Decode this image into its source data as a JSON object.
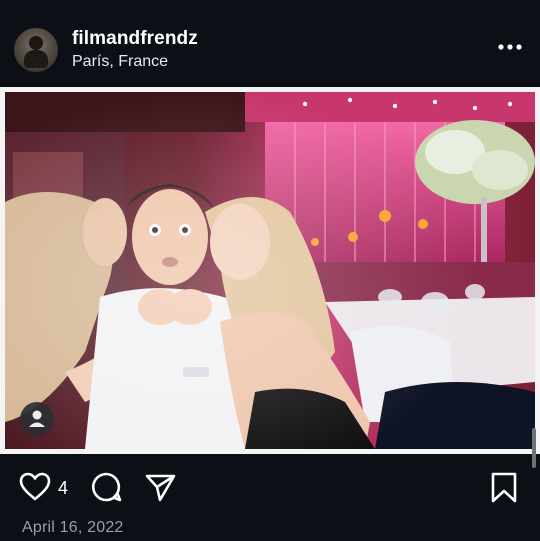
{
  "post": {
    "username": "filmandfrendz",
    "location": "París, France",
    "date": "April 16, 2022",
    "likes": "4"
  },
  "icons": {
    "more": "more-options-icon",
    "like": "heart-icon",
    "comment": "comment-icon",
    "share": "share-icon",
    "save": "bookmark-icon",
    "tag": "person-tag-icon"
  },
  "colors": {
    "background": "#0c0f16",
    "frame": "#f4f4f4",
    "secondary_text": "#9a9ea6",
    "scene_pink": "#d94a84"
  }
}
